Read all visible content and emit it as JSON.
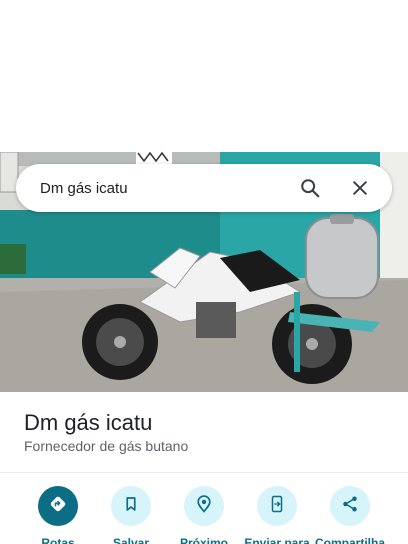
{
  "search": {
    "query": "Dm gás icatu"
  },
  "place": {
    "name": "Dm gás icatu",
    "category": "Fornecedor de gás butano"
  },
  "actions": [
    {
      "label": "Rotas",
      "icon": "directions-icon"
    },
    {
      "label": "Salvar",
      "icon": "bookmark-icon"
    },
    {
      "label": "Próximo",
      "icon": "nearby-icon"
    },
    {
      "label": "Enviar para",
      "icon": "send-to-phone-icon"
    },
    {
      "label": "Compartilha",
      "icon": "share-icon"
    }
  ],
  "colors": {
    "accent": "#0b6e84",
    "accent_light": "#d7f4fa"
  }
}
